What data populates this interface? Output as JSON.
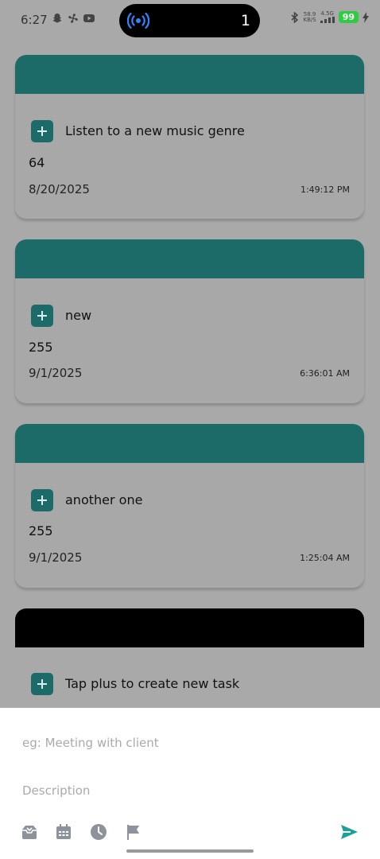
{
  "status_bar": {
    "time": "6:27",
    "island_count": "1",
    "net_speed_top": "58.9",
    "net_speed_bottom": "KB/S",
    "signal_label": "4.5G",
    "battery": "99"
  },
  "tasks": [
    {
      "title": "Listen to a new music genre",
      "number": "64",
      "date": "8/20/2025",
      "time": "1:49:12 PM"
    },
    {
      "title": "new",
      "number": "255",
      "date": "9/1/2025",
      "time": "6:36:01 AM"
    },
    {
      "title": "another one",
      "number": "255",
      "date": "9/1/2025",
      "time": "1:25:04 AM"
    }
  ],
  "empty_hint": "Tap plus to create new task",
  "sheet": {
    "title_placeholder": "eg: Meeting with client",
    "description_placeholder": "Description"
  },
  "colors": {
    "accent": "#1c6b68",
    "send": "#1aa19a",
    "overlay": "#a9a9a9"
  }
}
